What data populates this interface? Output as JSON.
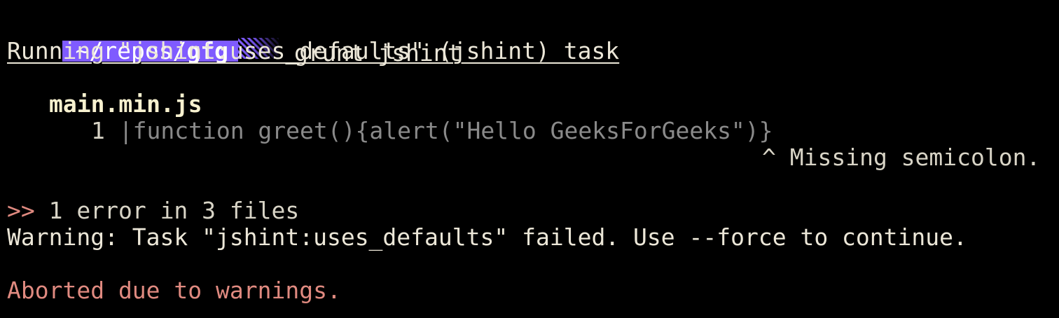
{
  "prompt": {
    "path_prefix": "~/repos/",
    "path_dir": "gfg",
    "command": "grunt jshint"
  },
  "output": {
    "task_line": "Running \"jshint:uses_defaults\" (jshint) task",
    "file_name": "main.min.js",
    "code_line_number": "1",
    "code_separator": "|",
    "code_text": "function greet(){alert(\"Hello GeeksForGeeks\")}",
    "error_marker": "^ Missing semicolon.",
    "summary_arrow": ">>",
    "summary_text": "1 error in 3 files",
    "warning_text": "Warning: Task \"jshint:uses_defaults\" failed. Use --force to continue.",
    "aborted_text": "Aborted due to warnings."
  },
  "colors": {
    "prompt_bg": "#7f5bff",
    "error_red": "#e08a80",
    "text": "#ece7d8",
    "code_gray": "#8a8a8a"
  }
}
